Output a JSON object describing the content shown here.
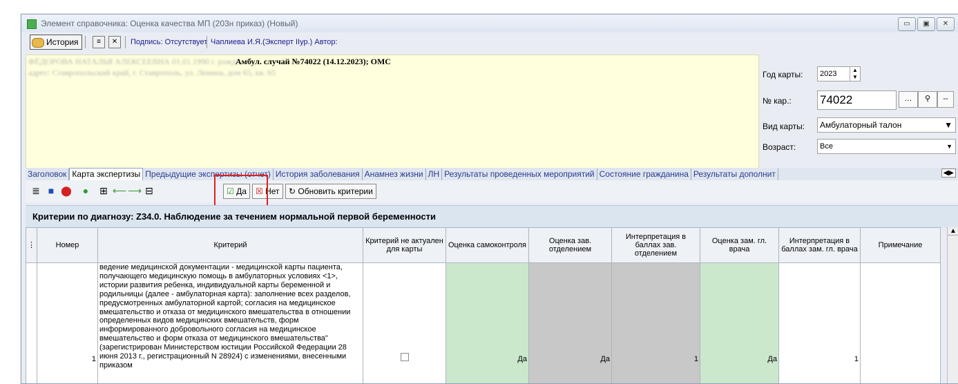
{
  "window": {
    "title": "Элемент справочника: Оценка качества МП (203н приказ) (Новый)",
    "controls": [
      "▭",
      "▣",
      "✕"
    ]
  },
  "toolbar": {
    "history_label": "История",
    "signature_text": "Подпись: Отсутствует",
    "expert_text": "Чаплиева И.Я.(Эксперт IIур.) Автор:"
  },
  "header": {
    "blurred_line1": "ФЁДОРОВА НАТАЛЬЯ АЛЕКСЕЕВНА 01.01.1990 г. рожд.",
    "blurred_line2": "адрес: Ставропольский край, г. Ставрополь, ул. Ленина, дом 65, кв. 65",
    "case_text": "Амбул. случай №74022 (14.12.2023); ОМС"
  },
  "right_panel": {
    "year_label": "Год карты:",
    "year_value": "2023",
    "card_no_label": "№ кар.:",
    "card_no_value": "74022",
    "card_type_label": "Вид карты:",
    "card_type_value": "Амбулаторный талон",
    "age_label": "Возраст:",
    "age_value": "Все"
  },
  "tabs": [
    "Заголовок",
    "Карта экспертизы",
    "Предыдущие экспертизы (отчет)",
    "История заболевания",
    "Анамнез жизни",
    "ЛН",
    "Результаты проведенных мероприятий",
    "Состояние гражданина",
    "Результаты дополнит"
  ],
  "tab_active_index": 1,
  "toolbar2": {
    "yes_label": "Да",
    "no_label": "Нет",
    "refresh_label": "Обновить критерии"
  },
  "criteria_title": "Критерии по диагнозу: Z34.0. Наблюдение за течением нормальной первой беременности",
  "table": {
    "columns": [
      "Номер",
      "Критерий",
      "Критерий не актуален для карты",
      "Оценка самоконтроля",
      "Оценка зав. отделением",
      "Интерпретация в баллах зав. отделением",
      "Оценка зам. гл. врача",
      "Интерпретация в баллах зам. гл. врача",
      "Примечание"
    ],
    "rows": [
      {
        "number": "1",
        "criterion": "ведение медицинской документации - медицинской карты пациента, получающего медицинскую помощь в амбулаторных условиях <1>, истории развития ребенка, индивидуальной карты беременной и родильницы (далее - амбулаторная карта): заполнение всех разделов, предусмотренных амбулаторной картой; согласия на медицинское вмешательство и отказа от медицинского вмешательства в отношении определенных видов медицинских вмешательств, форм информированного добровольного согласия на медицинское вмешательство и форм отказа от медицинского вмешательства\" (зарегистрирован Министерством юстиции Российской Федерации 28 июня 2013 г., регистрационный N 28924) с изменениями, внесенными приказом",
        "self": "Да",
        "head": "Да",
        "head_points": "1",
        "deputy": "Да",
        "deputy_points": "1"
      }
    ]
  },
  "colors": {
    "highlight": "#e02020",
    "green_cell": "#cce8cc",
    "gray_cell": "#c8c8c8",
    "yellow_panel": "#ffffdd"
  }
}
